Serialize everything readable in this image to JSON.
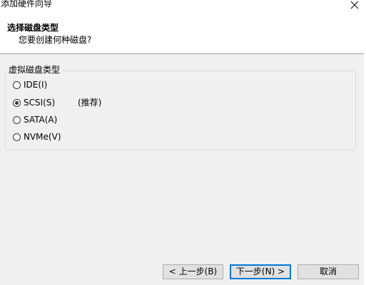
{
  "window": {
    "title": "添加硬件向导"
  },
  "header": {
    "title": "选择磁盘类型",
    "subtitle": "您要创建何种磁盘?"
  },
  "group": {
    "label": "虚拟磁盘类型",
    "options": [
      {
        "label": "IDE(I)",
        "selected": false
      },
      {
        "label": "SCSI(S)",
        "selected": true,
        "note": "(推荐)"
      },
      {
        "label": "SATA(A)",
        "selected": false
      },
      {
        "label": "NVMe(V)",
        "selected": false
      }
    ]
  },
  "buttons": {
    "back": "< 上一步(B)",
    "next": "下一步(N) >",
    "cancel": "取消"
  },
  "icons": {
    "close": "close-icon"
  },
  "colors": {
    "header_bg": "#ffffff",
    "dialog_bg": "#f0f0f0",
    "default_button_border": "#0078d7"
  }
}
